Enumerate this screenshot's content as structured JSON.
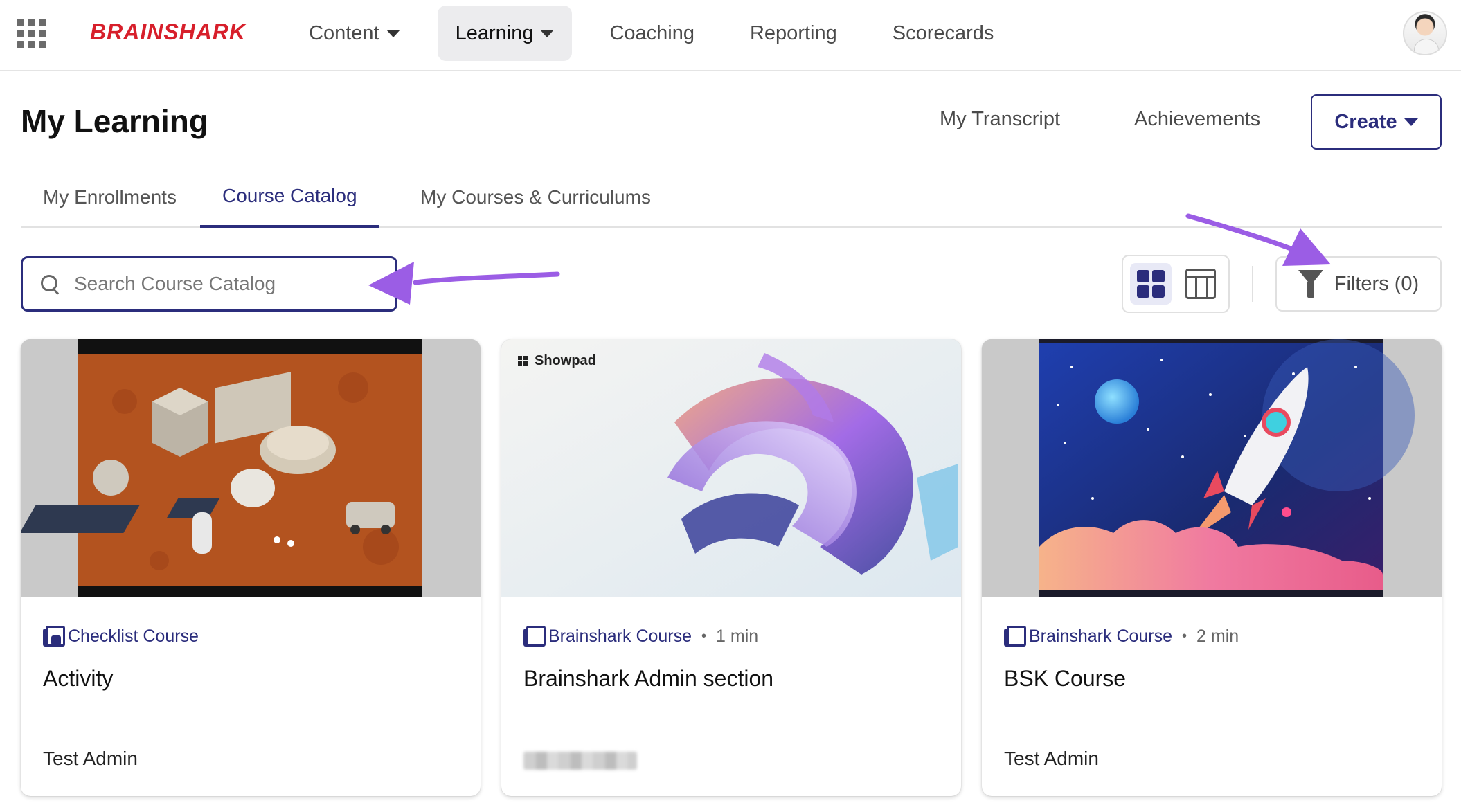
{
  "app": {
    "logo": "BRAINSHARK"
  },
  "nav": {
    "items": [
      {
        "label": "Content",
        "has_dropdown": true,
        "active": false
      },
      {
        "label": "Learning",
        "has_dropdown": true,
        "active": true
      },
      {
        "label": "Coaching",
        "has_dropdown": false,
        "active": false
      },
      {
        "label": "Reporting",
        "has_dropdown": false,
        "active": false
      },
      {
        "label": "Scorecards",
        "has_dropdown": false,
        "active": false
      }
    ]
  },
  "page": {
    "title": "My Learning",
    "links": {
      "transcript": "My Transcript",
      "achievements": "Achievements"
    },
    "create_label": "Create"
  },
  "tabs": [
    {
      "label": "My Enrollments",
      "active": false
    },
    {
      "label": "Course Catalog",
      "active": true
    },
    {
      "label": "My Courses & Curriculums",
      "active": false
    }
  ],
  "search": {
    "placeholder": "Search Course Catalog",
    "value": ""
  },
  "view_toggle": {
    "selected": "grid"
  },
  "filters": {
    "label": "Filters (0)"
  },
  "colors": {
    "accent": "#2b2d7c",
    "brand": "#d71f2b",
    "annotation_arrow": "#9b5de5"
  },
  "cards": [
    {
      "type": "Checklist Course",
      "duration": "",
      "title": "Activity",
      "author": "Test Admin",
      "author_blurred": false
    },
    {
      "type": "Brainshark Course",
      "duration": "1 min",
      "title": "Brainshark Admin section",
      "author": "",
      "author_blurred": true,
      "media_label": "Showpad"
    },
    {
      "type": "Brainshark Course",
      "duration": "2 min",
      "title": "BSK Course",
      "author": "Test Admin",
      "author_blurred": false
    }
  ]
}
